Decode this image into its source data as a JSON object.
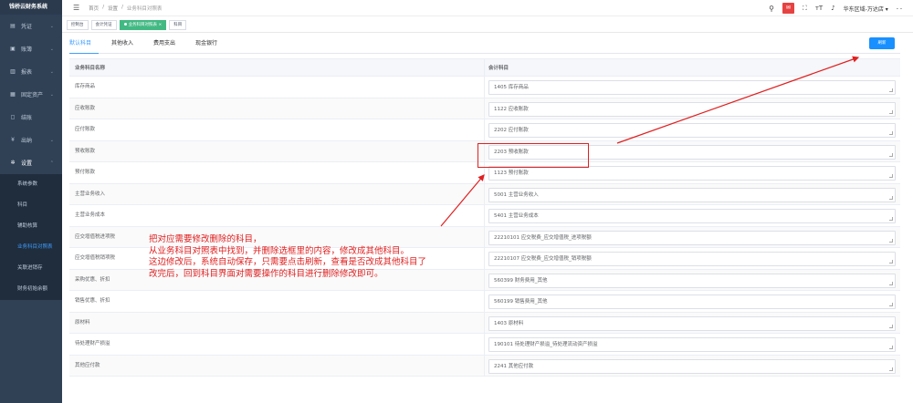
{
  "app": {
    "title": "钱桥云财务系统"
  },
  "sidebar": {
    "items": [
      {
        "label": "凭证",
        "icon": "voucher-icon"
      },
      {
        "label": "账簿",
        "icon": "book-icon"
      },
      {
        "label": "报表",
        "icon": "chart-icon"
      },
      {
        "label": "固定资产",
        "icon": "grid-icon"
      },
      {
        "label": "结账",
        "icon": "window-icon"
      },
      {
        "label": "出纳",
        "icon": "yen-icon"
      },
      {
        "label": "设置",
        "icon": "gear-icon"
      }
    ],
    "submenu": [
      "系统参数",
      "科目",
      "辅助核算",
      "业务科目对照表",
      "关联进销存",
      "财务初始余额"
    ],
    "active_submenu": "业务科目对照表"
  },
  "topbar": {
    "breadcrumb": [
      "首页",
      "设置",
      "业务科目对照表"
    ],
    "store": "华东区域-万达店",
    "more": "- -"
  },
  "tags": [
    {
      "label": "控制台"
    },
    {
      "label": "会计凭证"
    },
    {
      "label": "业务科目对照表",
      "active": true
    },
    {
      "label": "科目"
    }
  ],
  "tabs": [
    "默认科目",
    "其他收入",
    "费用支出",
    "现金银行"
  ],
  "active_tab": "默认科目",
  "refresh_label": "刷新",
  "table": {
    "headers": [
      "业务科目名称",
      "会计科目"
    ],
    "rows": [
      {
        "name": "库存商品",
        "account": "1405 库存商品"
      },
      {
        "name": "应收账款",
        "account": "1122 应收账款"
      },
      {
        "name": "应付账款",
        "account": "2202 应付账款"
      },
      {
        "name": "预收账款",
        "account": "2203 预收账款"
      },
      {
        "name": "预付账款",
        "account": "1123 预付账款"
      },
      {
        "name": "主营业务收入",
        "account": "5001 主营业务收入"
      },
      {
        "name": "主营业务成本",
        "account": "5401 主营业务成本"
      },
      {
        "name": "应交增值税进项税",
        "account": "22210101 应交税费_应交增值税_进项税额"
      },
      {
        "name": "应交增值税销项税",
        "account": "22210107 应交税费_应交增值税_销项税额"
      },
      {
        "name": "采购优惠、折扣",
        "account": "560399 财务费用_其他"
      },
      {
        "name": "销售优惠、折扣",
        "account": "560199 销售费用_其他"
      },
      {
        "name": "原材料",
        "account": "1403 原材料"
      },
      {
        "name": "待处理财产损溢",
        "account": "190101 待处理财产损溢_待处理流动资产损溢"
      },
      {
        "name": "其他应付款",
        "account": "2241 其他应付款"
      }
    ]
  },
  "annotation": {
    "lines": [
      "把对应需要修改删除的科目，",
      "从业务科目对照表中找到，并删除选框里的内容，修改成其他科目。",
      "这边修改后，系统自动保存，只需要点击刷新，查看是否改成其他科目了",
      "改完后，回到科目界面对需要操作的科目进行删除修改即可。"
    ],
    "color": "#e02020"
  }
}
